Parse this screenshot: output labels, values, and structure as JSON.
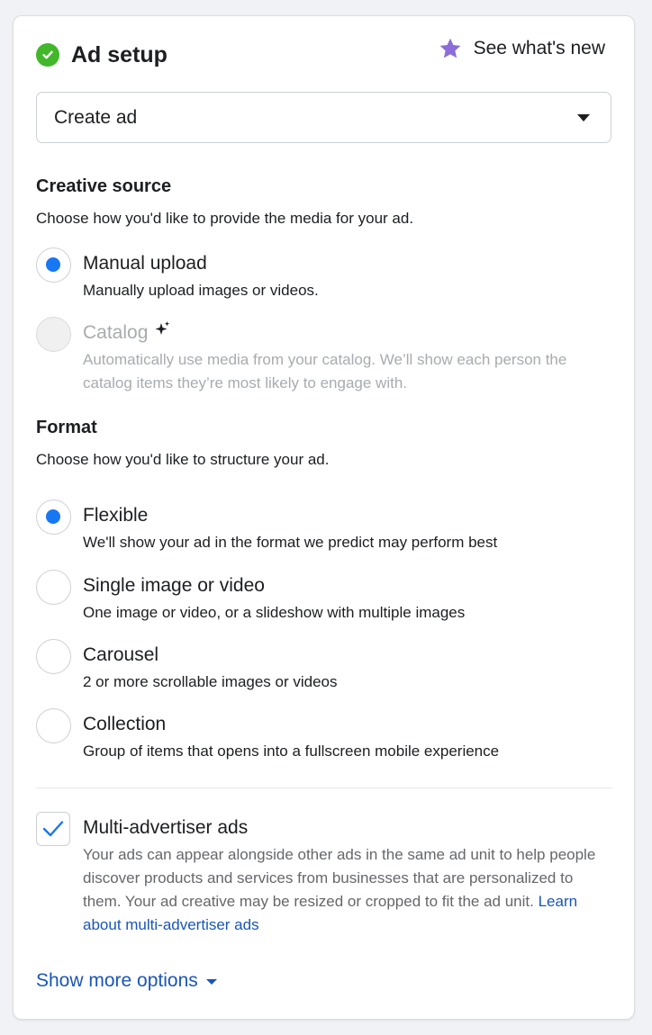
{
  "header": {
    "title": "Ad setup",
    "whats_new_label": "See what's new"
  },
  "ad_type_select": {
    "value": "Create ad"
  },
  "creative_source": {
    "title": "Creative source",
    "description": "Choose how you'd like to provide the media for your ad.",
    "options": [
      {
        "label": "Manual upload",
        "description": "Manually upload images or videos.",
        "selected": true,
        "disabled": false
      },
      {
        "label": "Catalog",
        "description": "Automatically use media from your catalog. We’ll show each person the catalog items they’re most likely to engage with.",
        "selected": false,
        "disabled": true
      }
    ]
  },
  "format": {
    "title": "Format",
    "description": "Choose how you'd like to structure your ad.",
    "options": [
      {
        "label": "Flexible",
        "description": "We'll show your ad in the format we predict may perform best",
        "selected": true
      },
      {
        "label": "Single image or video",
        "description": "One image or video, or a slideshow with multiple images",
        "selected": false
      },
      {
        "label": "Carousel",
        "description": "2 or more scrollable images or videos",
        "selected": false
      },
      {
        "label": "Collection",
        "description": "Group of items that opens into a fullscreen mobile experience",
        "selected": false
      }
    ]
  },
  "multi_advertiser": {
    "label": "Multi-advertiser ads",
    "checked": true,
    "description": "Your ads can appear alongside other ads in the same ad unit to help people discover products and services from businesses that are personalized to them. Your ad creative may be resized or cropped to fit the ad unit.",
    "link_text": "Learn about multi-advertiser ads"
  },
  "show_more_label": "Show more options",
  "icons": {
    "status": "check-circle-icon",
    "whats_new": "star-icon",
    "catalog_badge": "sparkle-icon",
    "checkbox": "checkmark-icon",
    "dropdown": "caret-down-icon"
  },
  "colors": {
    "accent_blue": "#1877f2",
    "link_blue": "#1a56b8",
    "success_green": "#42b72a",
    "star_purple": "#8c6cd8"
  }
}
